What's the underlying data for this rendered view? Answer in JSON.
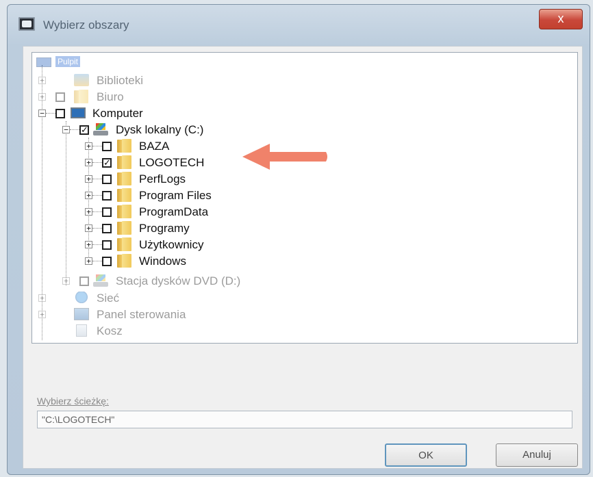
{
  "window": {
    "title": "Wybierz obszary",
    "close_label": "x"
  },
  "tree": {
    "root_label": "Pulpit",
    "items": [
      {
        "label": "Biblioteki"
      },
      {
        "label": "Biuro"
      },
      {
        "label": "Komputer"
      },
      {
        "label": "Dysk lokalny (C:)",
        "checked": true
      },
      {
        "label": "BAZA",
        "checked": false
      },
      {
        "label": "LOGOTECH",
        "checked": true
      },
      {
        "label": "PerfLogs",
        "checked": false
      },
      {
        "label": "Program Files",
        "checked": false
      },
      {
        "label": "ProgramData",
        "checked": false
      },
      {
        "label": "Programy",
        "checked": false
      },
      {
        "label": "Użytkownicy",
        "checked": false
      },
      {
        "label": "Windows",
        "checked": false
      },
      {
        "label": "Stacja dysków DVD (D:)"
      },
      {
        "label": "Sieć"
      },
      {
        "label": "Panel sterowania"
      },
      {
        "label": "Kosz"
      }
    ]
  },
  "path": {
    "label": "Wybierz ścieżkę:",
    "value": "\"C:\\LOGOTECH\""
  },
  "buttons": {
    "ok": "OK",
    "cancel": "Anuluj"
  },
  "colors": {
    "arrow": "#f0826a",
    "selection": "#3b76d6"
  }
}
